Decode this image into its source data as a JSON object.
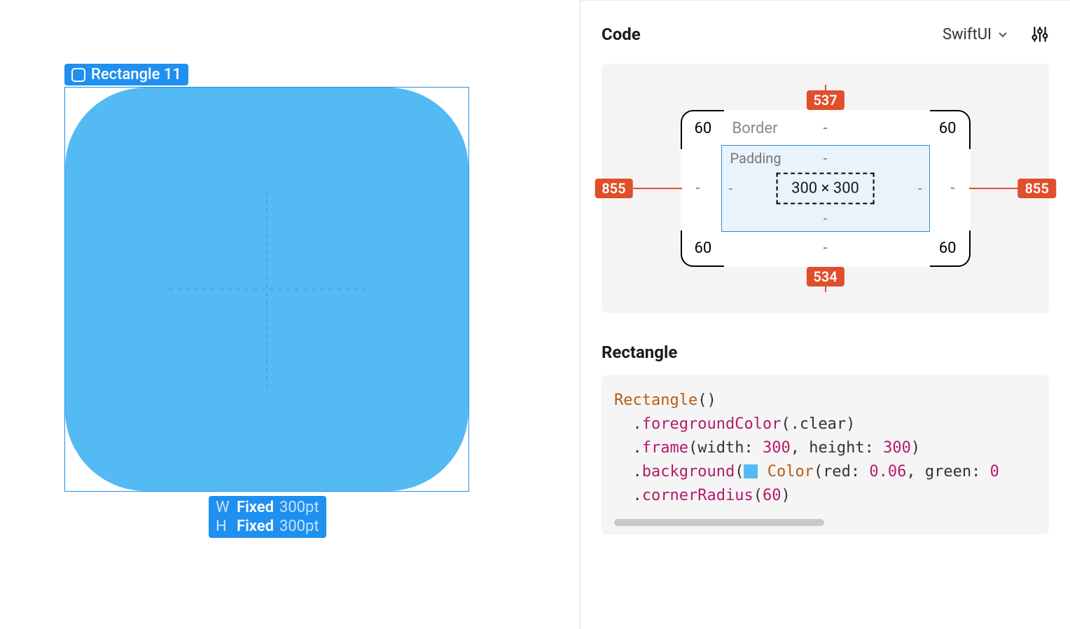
{
  "canvas": {
    "selection_label": "Rectangle 11",
    "dimensions": {
      "w": {
        "letter": "W",
        "mode": "Fixed",
        "value": "300pt"
      },
      "h": {
        "letter": "H",
        "mode": "Fixed",
        "value": "300pt"
      }
    }
  },
  "inspector": {
    "title": "Code",
    "framework": "SwiftUI",
    "box_model": {
      "border_label": "Border",
      "border_top_dash": "-",
      "border_bottom_dash": "-",
      "border_left_dash": "-",
      "border_right_dash": "-",
      "corner_tl": "60",
      "corner_tr": "60",
      "corner_bl": "60",
      "corner_br": "60",
      "padding_label": "Padding",
      "pad_t": "-",
      "pad_b": "-",
      "pad_l": "-",
      "pad_r": "-",
      "size": "300 × 300",
      "spacing_top": "537",
      "spacing_bottom": "534",
      "spacing_left": "855",
      "spacing_right": "855"
    },
    "element_name": "Rectangle",
    "code": {
      "l1_type": "Rectangle",
      "l1_rest": "()",
      "l2_indent": "  .",
      "l2_m": "foregroundColor",
      "l2_rest": "(.clear)",
      "l3_indent": "  .",
      "l3_m": "frame",
      "l3_a": "(width: ",
      "l3_n1": "300",
      "l3_b": ", height: ",
      "l3_n2": "300",
      "l3_c": ")",
      "l4_indent": "  .",
      "l4_m": "background",
      "l4_a": "(",
      "l4_color_word": "Color",
      "l4_b": "(red: ",
      "l4_n1": "0.06",
      "l4_c": ", green: ",
      "l4_n2": "0",
      "l5_indent": "  .",
      "l5_m": "cornerRadius",
      "l5_a": "(",
      "l5_n": "60",
      "l5_b": ")"
    }
  }
}
